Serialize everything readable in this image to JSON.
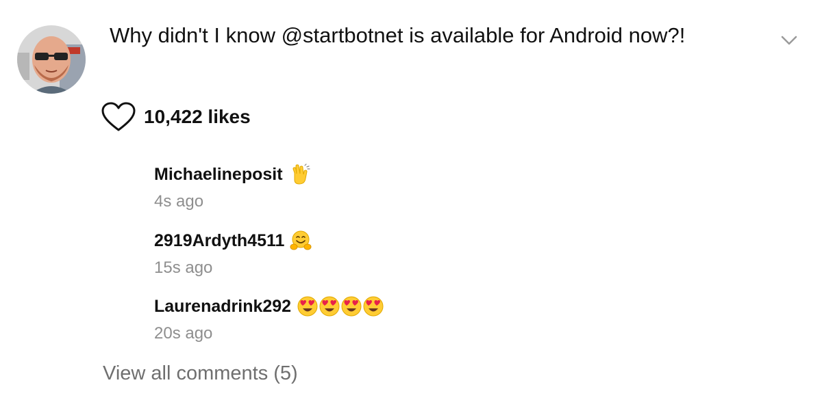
{
  "post": {
    "caption": "Why didn't I know @startbotnet is available for Android now?!",
    "likes": "10,422 likes",
    "avatar_icon": "profile-avatar",
    "more_icon": "chevron-down-icon",
    "like_icon": "heart-outline-icon"
  },
  "comments": [
    {
      "user": "Michaelineposit",
      "emojis": [
        "waving-hand-emoji"
      ],
      "time": "4s ago"
    },
    {
      "user": "2919Ardyth4511",
      "emojis": [
        "hugging-face-emoji"
      ],
      "time": "15s ago"
    },
    {
      "user": "Laurenadrink292",
      "emojis": [
        "heart-eyes-emoji",
        "heart-eyes-emoji",
        "heart-eyes-emoji",
        "heart-eyes-emoji"
      ],
      "time": "20s ago"
    }
  ],
  "view_all": "View all comments (5)",
  "colors": {
    "text": "#111111",
    "muted": "#8e8e8e",
    "link_muted": "#6f6f6f",
    "emoji_yellow": "#ffcc33",
    "emoji_heart": "#e8214a"
  }
}
